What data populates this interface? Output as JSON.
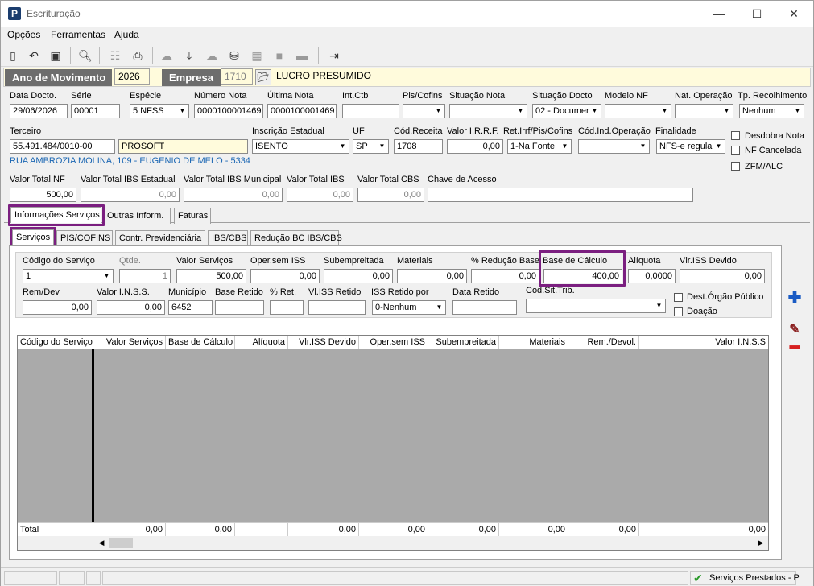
{
  "window": {
    "title": "Escrituração",
    "minimize": "—",
    "maximize": "☐",
    "close": "✕"
  },
  "menu": [
    "Opções",
    "Ferramentas",
    "Ajuda"
  ],
  "toolbar": [
    "new-icon",
    "undo-icon",
    "save-icon",
    "preview-icon",
    "tree-icon",
    "print-icon",
    "cloud-icon",
    "download-icon",
    "cloud-gray-icon",
    "cib-icon",
    "panel-icon",
    "panel-icon",
    "minus-icon",
    "exit-icon"
  ],
  "header": {
    "ano_label": "Ano de Movimento",
    "ano_value": "2026",
    "empresa_label": "Empresa",
    "empresa_code": "1710",
    "empresa_name": "LUCRO PRESUMIDO"
  },
  "row1": {
    "data_docto": {
      "label": "Data Docto.",
      "value": "29/06/2026"
    },
    "serie": {
      "label": "Série",
      "value": "00001"
    },
    "especie": {
      "label": "Espécie",
      "value": "5 NFSS"
    },
    "numero_nota": {
      "label": "Número Nota",
      "value": "0000100001469"
    },
    "ultima_nota": {
      "label": "Última Nota",
      "value": "0000100001469"
    },
    "int_ctb": {
      "label": "Int.Ctb",
      "value": ""
    },
    "pis_cofins": {
      "label": "Pis/Cofins",
      "value": ""
    },
    "situacao_nota": {
      "label": "Situação Nota",
      "value": ""
    },
    "situacao_docto": {
      "label": "Situação Docto",
      "value": "02 - Documer"
    },
    "modelo_nf": {
      "label": "Modelo NF",
      "value": ""
    },
    "nat_operacao": {
      "label": "Nat. Operação",
      "value": ""
    },
    "tp_recolhimento": {
      "label": "Tp. Recolhimento",
      "value": "Nenhum"
    }
  },
  "row2": {
    "terceiro": {
      "label": "Terceiro",
      "cnpj": "55.491.484/0010-00",
      "name": "PROSOFT"
    },
    "endereco": "RUA AMBROZIA MOLINA, 109 - EUGENIO DE MELO - 5334",
    "inscricao": {
      "label": "Inscrição Estadual",
      "value": "ISENTO"
    },
    "uf": {
      "label": "UF",
      "value": "SP"
    },
    "cod_receita": {
      "label": "Cód.Receita",
      "value": "1708"
    },
    "valor_irrf": {
      "label": "Valor I.R.R.F.",
      "value": "0,00"
    },
    "ret_irrf": {
      "label": "Ret.Irrf/Pis/Cofins",
      "value": "1-Na Fonte"
    },
    "cod_ind_op": {
      "label": "Cód.Ind.Operação",
      "value": ""
    },
    "finalidade": {
      "label": "Finalidade",
      "value": "NFS-e regula"
    },
    "checks": [
      "Desdobra Nota",
      "NF Cancelada",
      "ZFM/ALC"
    ]
  },
  "row3": {
    "valor_total_nf": {
      "label": "Valor Total NF",
      "value": "500,00"
    },
    "ibs_estadual": {
      "label": "Valor Total IBS Estadual",
      "value": "0,00"
    },
    "ibs_municipal": {
      "label": "Valor Total IBS Municipal",
      "value": "0,00"
    },
    "ibs": {
      "label": "Valor Total IBS",
      "value": "0,00"
    },
    "cbs": {
      "label": "Valor Total CBS",
      "value": "0,00"
    },
    "chave": {
      "label": "Chave de Acesso",
      "value": ""
    }
  },
  "tabs_outer": [
    "Informações Serviços",
    "Outras Inform.",
    "Faturas"
  ],
  "tabs_inner": [
    "Serviços",
    "PIS/COFINS",
    "Contr. Previdenciária",
    "IBS/CBS",
    "Redução BC IBS/CBS"
  ],
  "servicos": {
    "codigo": {
      "label": "Código do Serviço",
      "value": "1"
    },
    "qtde": {
      "label": "Qtde.",
      "value": "1"
    },
    "valor_servicos": {
      "label": "Valor Serviços",
      "value": "500,00"
    },
    "oper_sem_iss": {
      "label": "Oper.sem ISS",
      "value": "0,00"
    },
    "subempreitada": {
      "label": "Subempreitada",
      "value": "0,00"
    },
    "materiais": {
      "label": "Materiais",
      "value": "0,00"
    },
    "reducao_base": {
      "label": "% Redução Base",
      "value": "0,00"
    },
    "base_calculo": {
      "label": "Base de Cálculo",
      "value": "400,00"
    },
    "aliquota": {
      "label": "Alíquota",
      "value": "0,0000"
    },
    "vlr_iss_devido": {
      "label": "Vlr.ISS Devido",
      "value": "0,00"
    },
    "rem_dev": {
      "label": "Rem/Dev",
      "value": "0,00"
    },
    "valor_inss": {
      "label": "Valor I.N.S.S.",
      "value": "0,00"
    },
    "municipio": {
      "label": "Município",
      "value": "6452"
    },
    "base_retido": {
      "label": "Base Retido",
      "value": ""
    },
    "pct_ret": {
      "label": "% Ret.",
      "value": ""
    },
    "vl_iss_retido": {
      "label": "Vl.ISS Retido",
      "value": ""
    },
    "iss_retido_por": {
      "label": "ISS Retido por",
      "value": "0-Nenhum"
    },
    "data_retido": {
      "label": "Data Retido",
      "value": ""
    },
    "cod_sit_trib": {
      "label": "Cod.Sit.Trib.",
      "value": ""
    },
    "dest_orgao": "Dest.Órgão Público",
    "doacao": "Doação"
  },
  "grid": {
    "columns": [
      "Código do Serviço",
      "Valor Serviços",
      "Base de Cálculo",
      "Alíquota",
      "Vlr.ISS Devido",
      "Oper.sem ISS",
      "Subempreitada",
      "Materiais",
      "Rem./Devol.",
      "Valor I.N.S.S"
    ],
    "total_label": "Total",
    "totals": [
      "0,00",
      "0,00",
      "",
      "0,00",
      "0,00",
      "0,00",
      "0,00",
      "0,00",
      "0,00"
    ]
  },
  "side_buttons": [
    "add-icon",
    "edit-icon",
    "remove-icon"
  ],
  "status": {
    "text": "Serviços Prestados - P"
  },
  "colors": {
    "highlight": "#7b1f80",
    "yellow_field": "#fffbdc",
    "dark_label": "#6d6d6d",
    "link": "#1a66b3"
  }
}
